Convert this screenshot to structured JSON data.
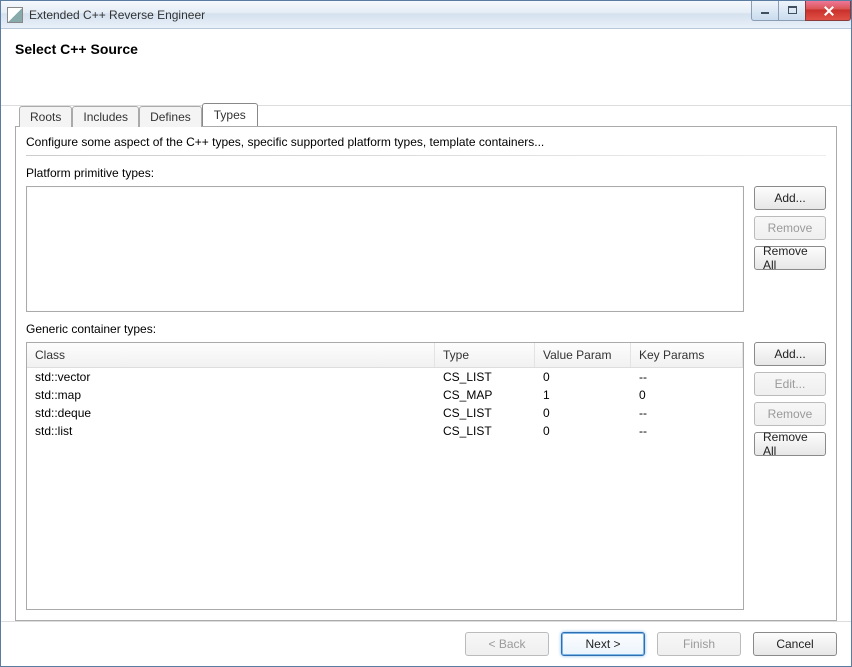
{
  "window_title": "Extended C++ Reverse Engineer",
  "header_title": "Select C++ Source",
  "tabs": {
    "roots": "Roots",
    "includes": "Includes",
    "defines": "Defines",
    "types": "Types"
  },
  "active_tab": "types",
  "types_panel": {
    "description": "Configure some aspect of the C++ types, specific supported platform types, template containers...",
    "primitive_label": "Platform primitive types:",
    "container_label": "Generic container types:"
  },
  "primitive_buttons": {
    "add": "Add...",
    "remove": "Remove",
    "remove_all": "Remove All"
  },
  "container_buttons": {
    "add": "Add...",
    "edit": "Edit...",
    "remove": "Remove",
    "remove_all": "Remove All"
  },
  "container_table": {
    "headers": {
      "class": "Class",
      "type": "Type",
      "value_param": "Value Param",
      "key_params": "Key Params"
    },
    "rows": [
      {
        "class": "std::vector",
        "type": "CS_LIST",
        "value_param": "0",
        "key_params": "--"
      },
      {
        "class": "std::map",
        "type": "CS_MAP",
        "value_param": "1",
        "key_params": "0"
      },
      {
        "class": "std::deque",
        "type": "CS_LIST",
        "value_param": "0",
        "key_params": "--"
      },
      {
        "class": "std::list",
        "type": "CS_LIST",
        "value_param": "0",
        "key_params": "--"
      }
    ]
  },
  "footer": {
    "back": "< Back",
    "next": "Next >",
    "finish": "Finish",
    "cancel": "Cancel"
  }
}
